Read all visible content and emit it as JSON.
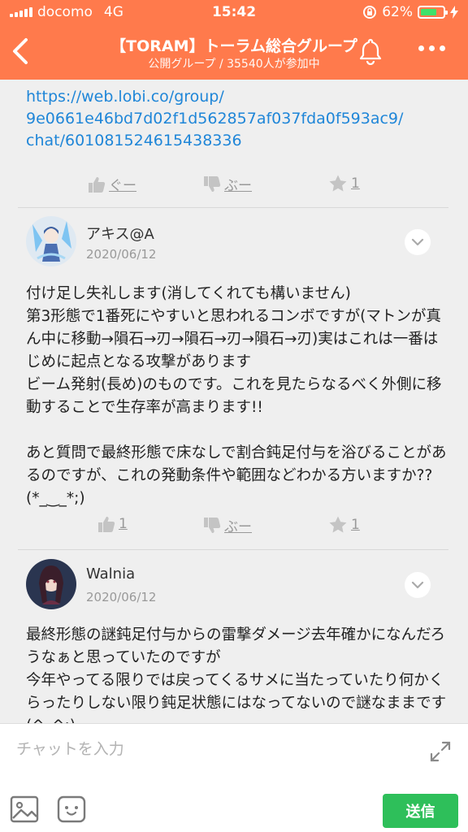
{
  "status_bar": {
    "carrier": "docomo",
    "network": "4G",
    "time": "15:42",
    "battery": "62%"
  },
  "nav": {
    "title": "【TORAM】トーラム総合グループ",
    "subtitle": "公開グループ / 35540人が参加中"
  },
  "link_message": {
    "text": "https://web.lobi.co/group/\n9e0661e46bd7d02f1d562857af037fda0f593ac9/\nchat/601081524615438336",
    "like_label": "ぐー",
    "dislike_label": "ぶー",
    "star_count": "1"
  },
  "posts": [
    {
      "author": "アキス@A",
      "date": "2020/06/12",
      "text": "付け足し失礼します(消してくれても構いません)\n第3形態で1番死にやすいと思われるコンボですが(マトンが真ん中に移動→隕石→刃→隕石→刃→隕石→刃)実はこれは一番はじめに起点となる攻撃があります\nビーム発射(長め)のものです。これを見たらなるべく外側に移動することで生存率が高まります!!\n\nあと質問で最終形態で床なしで割合鈍足付与を浴びることがあるのですが、これの発動条件や範囲などわかる方いますか??(*_‿_*;)",
      "like_count": "1",
      "dislike_label": "ぶー",
      "star_count": "1"
    },
    {
      "author": "Walnia",
      "date": "2020/06/12",
      "text": "最終形態の謎鈍足付与からの雷撃ダメージ去年確かになんだろうなぁと思っていたのですが\n今年やってる限りでは戻ってくるサメに当たっていたり何かくらったりしない限り鈍足状態にはなってないので謎なままです(^_^;)"
    }
  ],
  "input": {
    "placeholder": "チャットを入力",
    "send_label": "送信"
  },
  "colors": {
    "header": "#ff7a4c",
    "link": "#1f86d8",
    "send": "#2ebf5a",
    "battery": "#3fe26a"
  }
}
